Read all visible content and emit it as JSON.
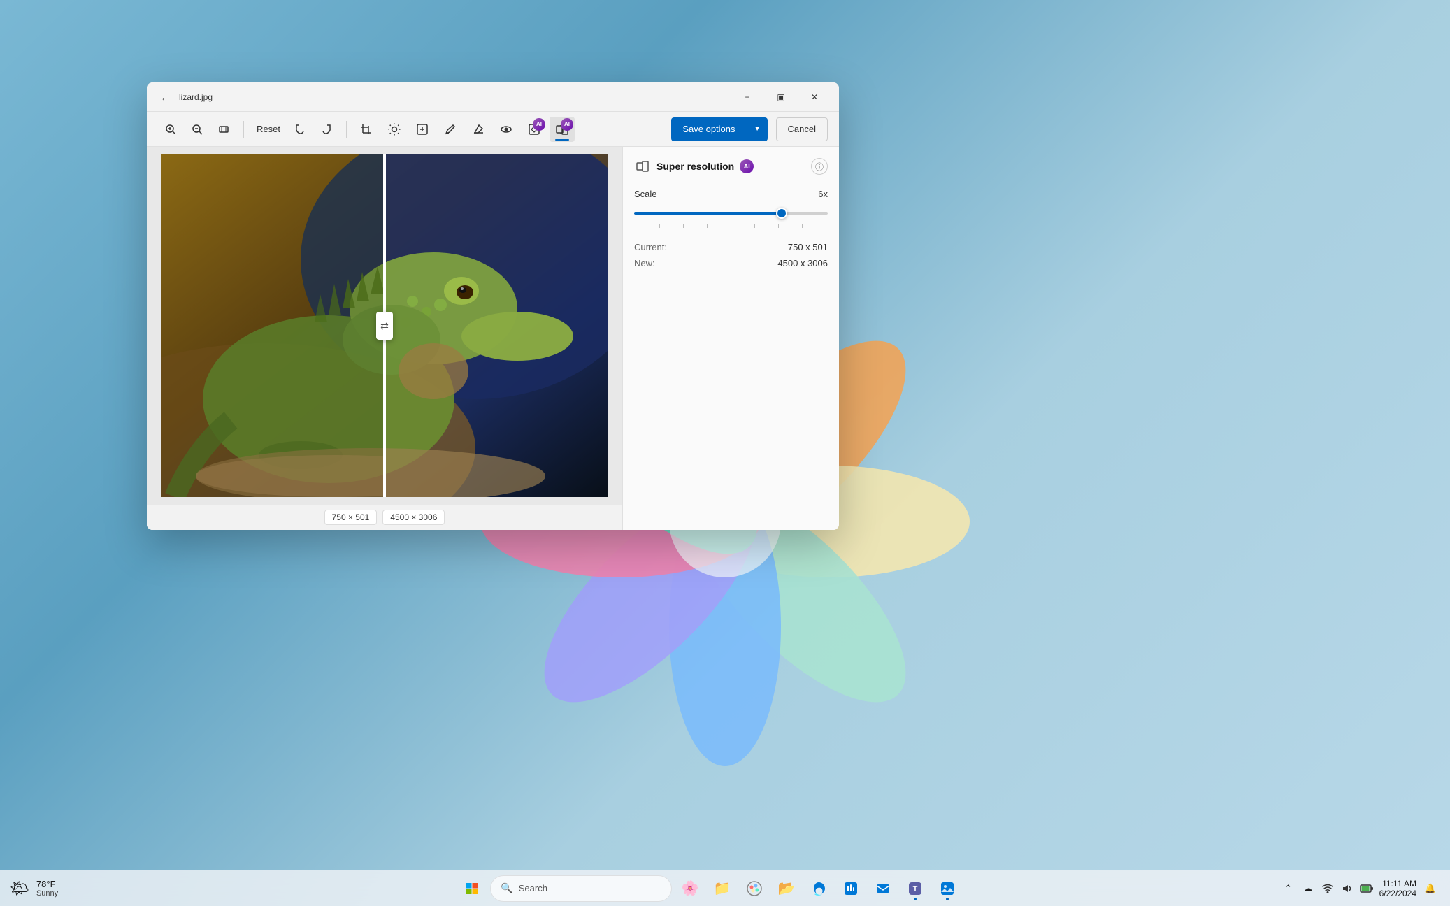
{
  "desktop": {
    "background": "Windows 11 default wallpaper"
  },
  "window": {
    "title": "lizard.jpg",
    "toolbar": {
      "reset_label": "Reset",
      "save_options_label": "Save options",
      "cancel_label": "Cancel"
    }
  },
  "panel": {
    "title": "Super resolution",
    "ai_badge": "AI",
    "scale_label": "Scale",
    "scale_value": "6x",
    "current_label": "Current:",
    "current_value": "750 x 501",
    "new_label": "New:",
    "new_value": "4500 x 3006"
  },
  "image": {
    "left_size": "750 × 501",
    "right_size": "4500 × 3006"
  },
  "taskbar": {
    "weather_temp": "78°F",
    "weather_desc": "Sunny",
    "search_placeholder": "Search",
    "clock_time": "11:11 AM",
    "clock_date": "6/22/2024"
  }
}
